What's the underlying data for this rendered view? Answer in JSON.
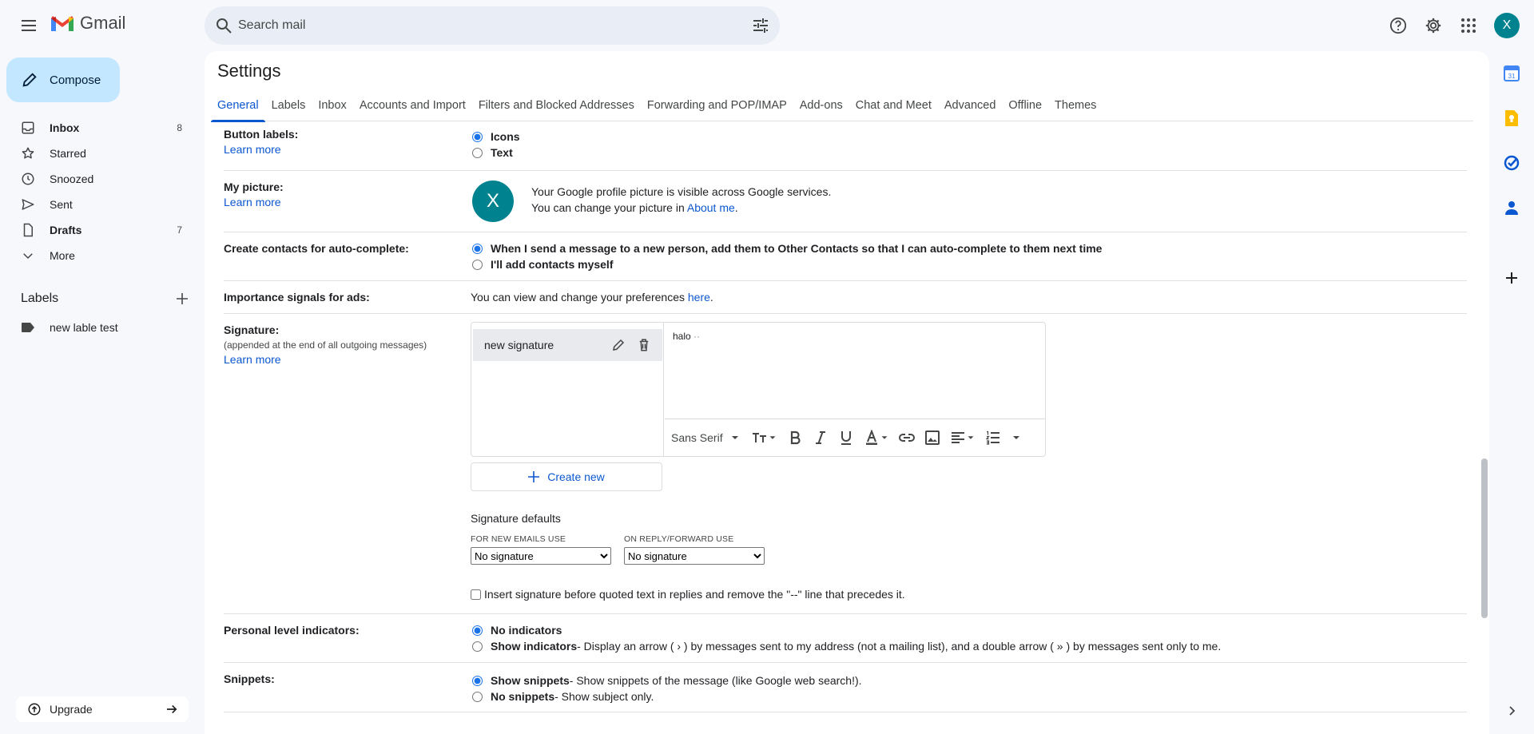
{
  "app": {
    "name": "Gmail"
  },
  "search": {
    "placeholder": "Search mail"
  },
  "account": {
    "initial": "X"
  },
  "compose": {
    "label": "Compose"
  },
  "nav": {
    "items": [
      {
        "label": "Inbox",
        "count": "8"
      },
      {
        "label": "Starred",
        "count": ""
      },
      {
        "label": "Snoozed",
        "count": ""
      },
      {
        "label": "Sent",
        "count": ""
      },
      {
        "label": "Drafts",
        "count": "7"
      },
      {
        "label": "More",
        "count": ""
      }
    ]
  },
  "labels": {
    "header": "Labels",
    "items": [
      {
        "label": "new lable test"
      }
    ]
  },
  "upgrade": {
    "label": "Upgrade"
  },
  "settings": {
    "title": "Settings",
    "tabs": [
      "General",
      "Labels",
      "Inbox",
      "Accounts and Import",
      "Filters and Blocked Addresses",
      "Forwarding and POP/IMAP",
      "Add-ons",
      "Chat and Meet",
      "Advanced",
      "Offline",
      "Themes"
    ],
    "learn_more": "Learn more",
    "button_labels": {
      "title": "Button labels:",
      "options": [
        "Icons",
        "Text"
      ],
      "selected": "Icons"
    },
    "my_picture": {
      "title": "My picture:",
      "line1": "Your Google profile picture is visible across Google services.",
      "line2_prefix": "You can change your picture in ",
      "link": "About me",
      "line2_suffix": "."
    },
    "contacts": {
      "title": "Create contacts for auto-complete:",
      "options": [
        "When I send a message to a new person, add them to Other Contacts so that I can auto-complete to them next time",
        "I'll add contacts myself"
      ],
      "selected": 0
    },
    "importance": {
      "title": "Importance signals for ads:",
      "prefix": "You can view and change your preferences ",
      "link": "here",
      "suffix": "."
    },
    "signature": {
      "title": "Signature:",
      "subtitle": "(appended at the end of all outgoing messages)",
      "items": [
        {
          "name": "new signature"
        }
      ],
      "body": "halo",
      "font": "Sans Serif",
      "create_new": "Create new",
      "defaults_title": "Signature defaults",
      "new_emails_caption": "FOR NEW EMAILS USE",
      "new_emails_value": "No signature",
      "reply_caption": "ON REPLY/FORWARD USE",
      "reply_value": "No signature",
      "insert_before_quoted": "Insert signature before quoted text in replies and remove the \"--\" line that precedes it."
    },
    "personal_indicators": {
      "title": "Personal level indicators:",
      "options": [
        {
          "label": "No indicators",
          "desc": ""
        },
        {
          "label": "Show indicators",
          "desc": " - Display an arrow ( › ) by messages sent to my address (not a mailing list), and a double arrow ( » ) by messages sent only to me."
        }
      ],
      "selected": 0
    },
    "snippets": {
      "title": "Snippets:",
      "options": [
        {
          "label": "Show snippets",
          "desc": " - Show snippets of the message (like Google web search!)."
        },
        {
          "label": "No snippets",
          "desc": " - Show subject only."
        }
      ],
      "selected": 0
    }
  },
  "colors": {
    "accent": "#0b57d0",
    "compose_bg": "#c2e7ff",
    "avatar": "#00838f",
    "page_bg": "#f6f8fc"
  }
}
